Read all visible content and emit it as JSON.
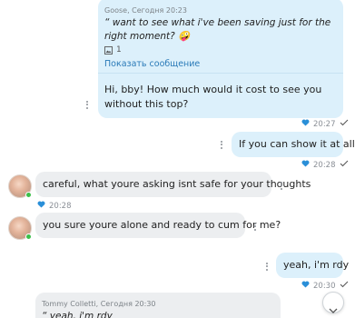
{
  "messages": [
    {
      "sender": "Goose, Сегодня 20:23",
      "quote": "“ want to see what i've been saving just for the right moment? 🤪",
      "attachment_count": "1",
      "show_message_label": "Показать сообщение",
      "text": "Hi, bby! How much would it cost to see you without this top?",
      "time": "20:27"
    },
    {
      "text": "If you can show it at all",
      "time": "20:28"
    },
    {
      "text": "careful, what youre asking isnt safe for your thoughts",
      "time": "20:28"
    },
    {
      "text": "you sure youre alone and ready to cum for me?"
    },
    {
      "text": "yeah, i'm rdy",
      "time": "20:30"
    },
    {
      "sender": "Tommy Colletti, Сегодня 20:30",
      "quote": "“ yeah, i'm rdy"
    }
  ],
  "colors": {
    "outgoing_bubble": "#dcf0fb",
    "incoming_bubble": "#eceef0",
    "heart": "#2a8fd8",
    "link": "#2a7ab8",
    "online": "#3cc04a"
  },
  "icons": [
    "more-dots-icon",
    "heart-icon",
    "read-check-icon",
    "image-icon",
    "chevron-down-icon"
  ]
}
